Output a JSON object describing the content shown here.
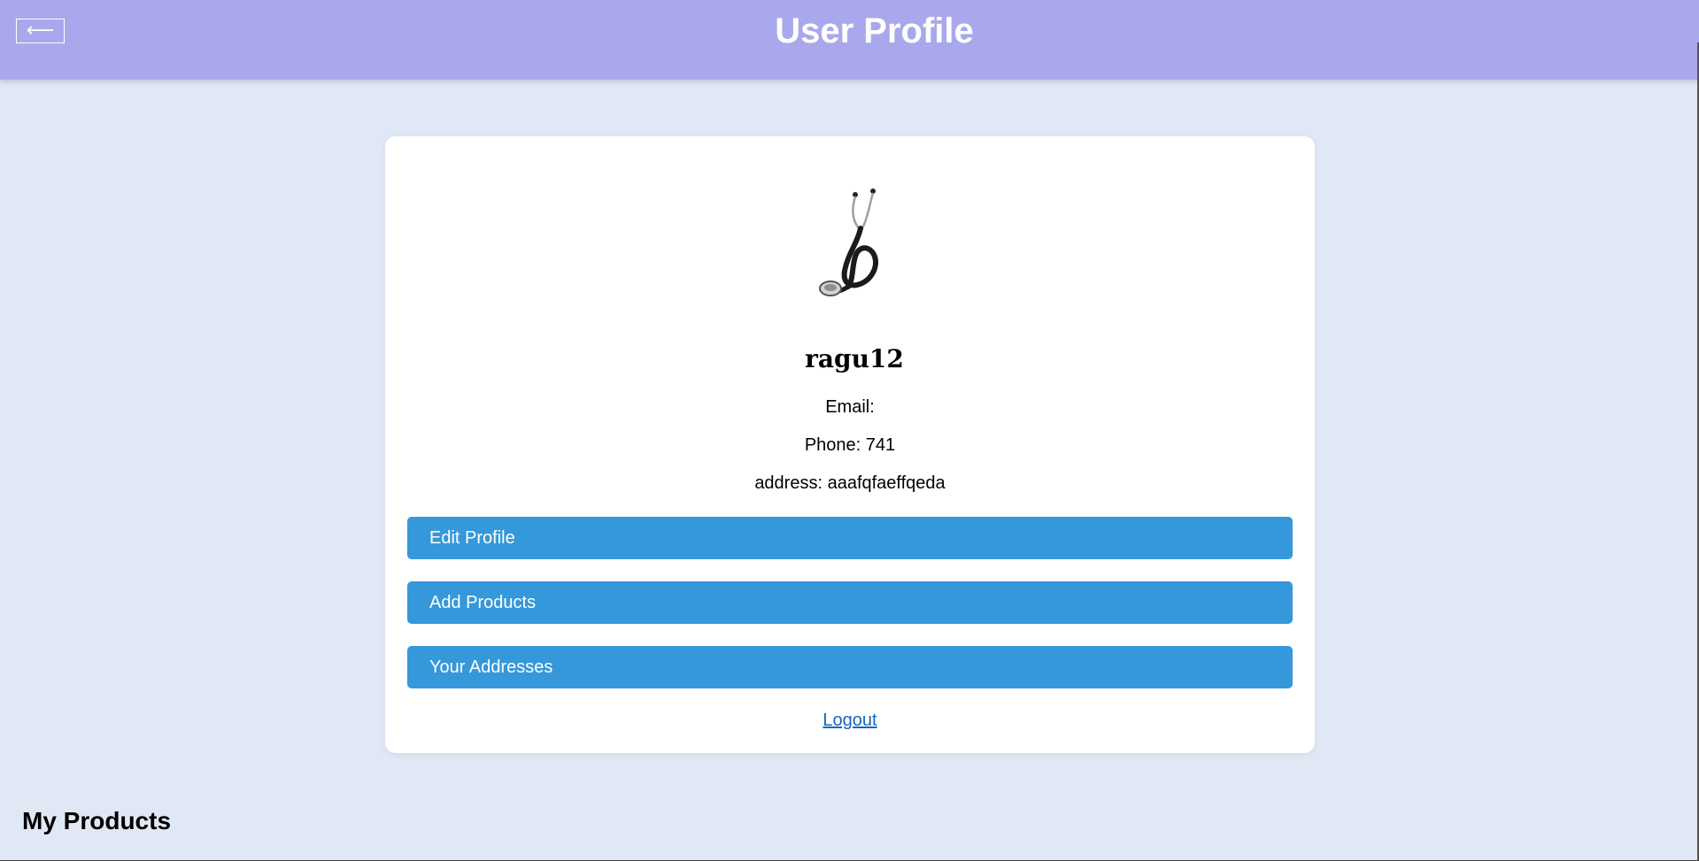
{
  "header": {
    "back_label": "⟵",
    "title": "User Profile"
  },
  "profile": {
    "avatar_icon": "stethoscope-icon",
    "username": "ragu12",
    "email": "Email: ",
    "phone": "Phone: 741",
    "address": "address: aaafqfaeffqeda"
  },
  "actions": {
    "edit_profile": "Edit Profile",
    "add_products": "Add Products",
    "your_addresses": "Your Addresses",
    "logout": "Logout"
  },
  "sections": {
    "my_products": "My Products"
  },
  "colors": {
    "header_bg": "#aaa8ec",
    "page_bg": "#e1e8f5",
    "button_bg": "#3498db",
    "link": "#1565c0"
  }
}
